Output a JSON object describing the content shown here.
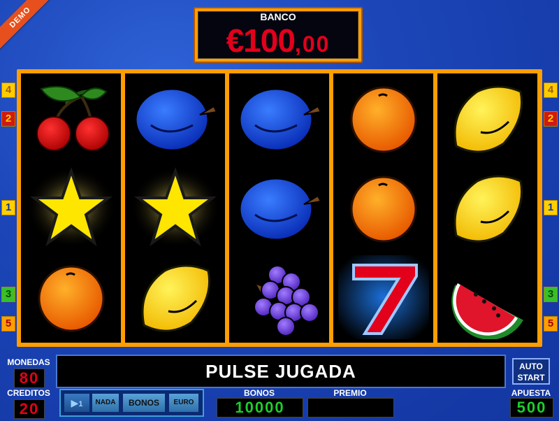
{
  "demo_badge": "DEMO",
  "banco": {
    "label": "BANCO",
    "amount_main": "€100",
    "amount_cents": ",00"
  },
  "line_numbers_left": [
    "4",
    "2",
    "1",
    "3",
    "5"
  ],
  "line_numbers_right": [
    "4",
    "2",
    "1",
    "3",
    "5"
  ],
  "reels": [
    [
      "cherries-icon",
      "star-icon",
      "orange-icon"
    ],
    [
      "plum-icon",
      "star-icon",
      "lemon-icon"
    ],
    [
      "plum-icon",
      "plum-icon",
      "grapes-icon"
    ],
    [
      "orange-icon",
      "orange-icon",
      "seven-icon"
    ],
    [
      "lemon-icon",
      "lemon-icon",
      "watermelon-icon"
    ]
  ],
  "colors": {
    "accent": "#ff9e00",
    "red_digits": "#e3001b",
    "green_digits": "#1ccf2a",
    "background": "#1c46b8"
  },
  "monedas": {
    "label": "MONEDAS",
    "value": "80"
  },
  "creditos": {
    "label": "CREDITOS",
    "value": "20"
  },
  "message": "PULSE JUGADA",
  "auto_start": {
    "line1": "AUTO",
    "line2": "START"
  },
  "buttons": {
    "play_label": "1",
    "nada": "NADA",
    "bonos": "BONOS",
    "euro": "EURO"
  },
  "bonos": {
    "label": "BONOS",
    "value": "10000"
  },
  "premio": {
    "label": "PREMIO",
    "value": ""
  },
  "apuesta": {
    "label": "APUESTA",
    "value": "500"
  }
}
